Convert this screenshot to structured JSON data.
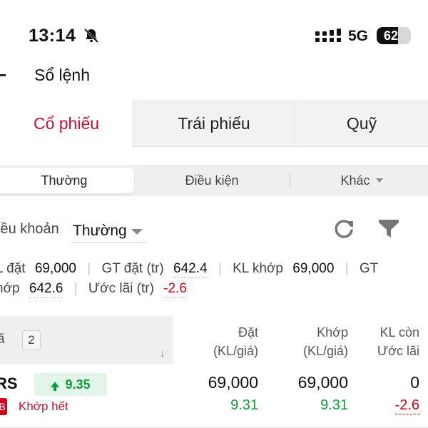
{
  "status_bar": {
    "time": "13:14",
    "network": "5G",
    "battery": "62",
    "battery_level_pct": 62
  },
  "header": {
    "title": "Sổ lệnh",
    "back_icon": "chevron-left-icon"
  },
  "main_tabs": [
    {
      "label": "Cổ phiếu",
      "active": true
    },
    {
      "label": "Trái phiếu",
      "active": false
    },
    {
      "label": "Quỹ",
      "active": false
    }
  ],
  "sub_tabs": [
    {
      "label": "Thường",
      "active": true
    },
    {
      "label": "Điều kiện",
      "active": false
    },
    {
      "label": "Khác",
      "active": false,
      "has_dropdown": true
    }
  ],
  "filter": {
    "label": "iều khoản",
    "value": "Thường",
    "refresh_icon": "refresh-icon",
    "filter_icon": "funnel-icon"
  },
  "summary": {
    "kl_dat_label": "L đặt",
    "kl_dat_value": "69,000",
    "gt_dat_label": "GT đặt (tr)",
    "gt_dat_value": "642.4",
    "kl_khop_label": "KL khớp",
    "kl_khop_value": "69,000",
    "gt_khop_label_part1": "GT",
    "gt_khop_label_part2": "hớp",
    "gt_khop_value": "642.6",
    "uoc_lai_label": "Ước lãi (tr)",
    "uoc_lai_value": "-2.6"
  },
  "table": {
    "col_ma": "ã",
    "count": "2",
    "sort_icon": "↓",
    "col_dat_1": "Đặt",
    "col_dat_2": "(KL/giá)",
    "col_khop_1": "Khớp",
    "col_khop_2": "(KL/giá)",
    "col_con_1": "KL còn",
    "col_con_2": "Ước lãi",
    "rows": [
      {
        "symbol": "RS",
        "last_price": "9.35",
        "side": "B",
        "status": "Khớp hết",
        "dat_kl": "69,000",
        "dat_gia": "9.31",
        "khop_kl": "69,000",
        "khop_gia": "9.31",
        "kl_con": "0",
        "uoc_lai": "-2.6"
      }
    ]
  },
  "colors": {
    "accent_red": "#c8102e",
    "loss_red": "#d0021b",
    "gain_green": "#109a3c",
    "tab_bg": "#f2f2f2"
  }
}
